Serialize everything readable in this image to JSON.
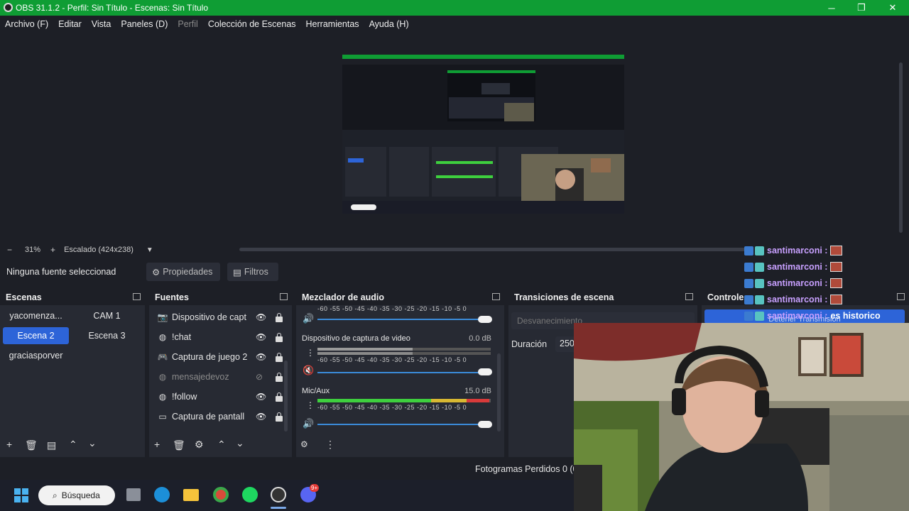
{
  "window": {
    "title": "OBS 31.1.2 - Perfil: Sin Título - Escenas: Sin Título",
    "minimize": "─",
    "maximize": "❐",
    "close": "✕"
  },
  "menu": [
    "Archivo (F)",
    "Editar",
    "Vista",
    "Paneles (D)",
    "Perfil",
    "Colección de Escenas",
    "Herramientas",
    "Ayuda (H)"
  ],
  "zoom": {
    "minus": "−",
    "level": "31%",
    "plus": "+",
    "scale_label": "Escalado (424x238)"
  },
  "source_bar": {
    "no_source": "Ninguna fuente seleccionad",
    "properties": "Propiedades",
    "filters": "Filtros"
  },
  "scenes": {
    "title": "Escenas",
    "items": [
      "yacomenza...",
      "CAM 1",
      "Escena 2",
      "Escena 3",
      "graciasporver"
    ],
    "active": "Escena 2"
  },
  "sources": {
    "title": "Fuentes",
    "items": [
      {
        "label": "Dispositivo de capt",
        "icon": "camera-icon",
        "visible": true
      },
      {
        "label": "!chat",
        "icon": "globe-icon",
        "visible": true
      },
      {
        "label": "Captura de juego 2",
        "icon": "gamepad-icon",
        "visible": true
      },
      {
        "label": "mensajedevoz",
        "icon": "globe-icon",
        "visible": false
      },
      {
        "label": "!follow",
        "icon": "globe-icon",
        "visible": true
      },
      {
        "label": "Captura de pantall",
        "icon": "monitor-icon",
        "visible": true
      }
    ]
  },
  "mixer": {
    "title": "Mezclador de audio",
    "scale": "-60  -55  -50  -45  -40  -35  -30  -25  -20  -15  -10   -5    0",
    "channels": [
      {
        "name": "Dispositivo de captura de video",
        "db": "0.0 dB",
        "muted": true,
        "level": 0.55
      },
      {
        "name": "Mic/Aux",
        "db": "15.0 dB",
        "muted": false,
        "level": 0.98
      }
    ]
  },
  "transitions": {
    "title": "Transiciones de escena",
    "selected": "Desvanecimiento",
    "duration_label": "Duración",
    "duration_value": "250"
  },
  "controls": {
    "title": "Controle",
    "stop_stream": "Detener Transmisión"
  },
  "status": {
    "dropped_frames": "Fotogramas Perdidos 0 (0"
  },
  "chat": [
    {
      "user": "santimarconi :",
      "msg": ""
    },
    {
      "user": "santimarconi :",
      "msg": ""
    },
    {
      "user": "santimarconi :",
      "msg": ""
    },
    {
      "user": "santimarconi :",
      "msg": ""
    },
    {
      "user": "santimarconi :",
      "msg": "es historico"
    }
  ],
  "taskbar": {
    "search": "Búsqueda",
    "badge": "9+"
  },
  "colors": {
    "title_green": "#0f9d34",
    "accent_blue": "#2d64d8",
    "meter_green": "#3ecf3e",
    "meter_yellow": "#d8b832",
    "meter_red": "#d83a3a"
  }
}
